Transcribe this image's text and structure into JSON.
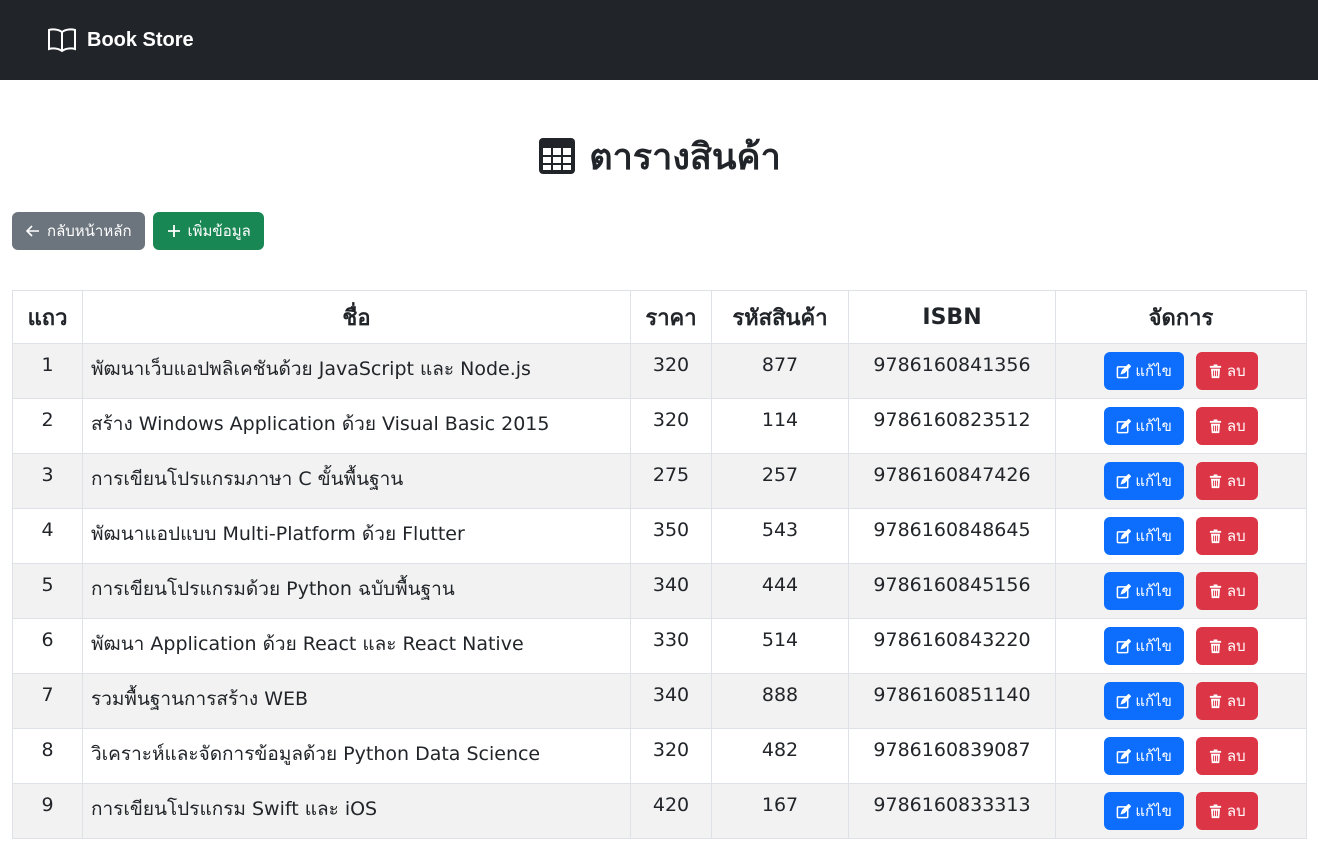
{
  "navbar": {
    "brand": "Book Store",
    "brand_icon": "book-open-icon"
  },
  "page": {
    "title": "ตารางสินค้า",
    "title_icon": "table-icon"
  },
  "actions": {
    "back_label": "กลับหน้าหลัก",
    "add_label": "เพิ่มข้อมูล"
  },
  "table": {
    "headers": {
      "row": "แถว",
      "name": "ชื่อ",
      "price": "ราคา",
      "code": "รหัสสินค้า",
      "isbn": "ISBN",
      "manage": "จัดการ"
    },
    "edit_label": "แก้ไข",
    "delete_label": "ลบ",
    "rows": [
      {
        "no": "1",
        "name": "พัฒนาเว็บแอปพลิเคชันด้วย JavaScript และ Node.js",
        "price": "320",
        "code": "877",
        "isbn": "9786160841356"
      },
      {
        "no": "2",
        "name": "สร้าง Windows Application ด้วย Visual Basic 2015",
        "price": "320",
        "code": "114",
        "isbn": "9786160823512"
      },
      {
        "no": "3",
        "name": "การเขียนโปรแกรมภาษา C ขั้นพื้นฐาน",
        "price": "275",
        "code": "257",
        "isbn": "9786160847426"
      },
      {
        "no": "4",
        "name": "พัฒนาแอปแบบ Multi-Platform ด้วย Flutter",
        "price": "350",
        "code": "543",
        "isbn": "9786160848645"
      },
      {
        "no": "5",
        "name": "การเขียนโปรแกรมด้วย Python ฉบับพื้นฐาน",
        "price": "340",
        "code": "444",
        "isbn": "9786160845156"
      },
      {
        "no": "6",
        "name": "พัฒนา Application ด้วย React และ React Native",
        "price": "330",
        "code": "514",
        "isbn": "9786160843220"
      },
      {
        "no": "7",
        "name": "รวมพื้นฐานการสร้าง WEB",
        "price": "340",
        "code": "888",
        "isbn": "9786160851140"
      },
      {
        "no": "8",
        "name": "วิเคราะห์และจัดการข้อมูลด้วย Python Data Science",
        "price": "320",
        "code": "482",
        "isbn": "9786160839087"
      },
      {
        "no": "9",
        "name": "การเขียนโปรแกรม Swift และ iOS",
        "price": "420",
        "code": "167",
        "isbn": "9786160833313"
      }
    ]
  },
  "colors": {
    "navbar": "#212529",
    "secondary": "#6c757d",
    "success": "#198754",
    "primary": "#0d6efd",
    "danger": "#dc3545",
    "stripe": "#f2f2f2"
  }
}
